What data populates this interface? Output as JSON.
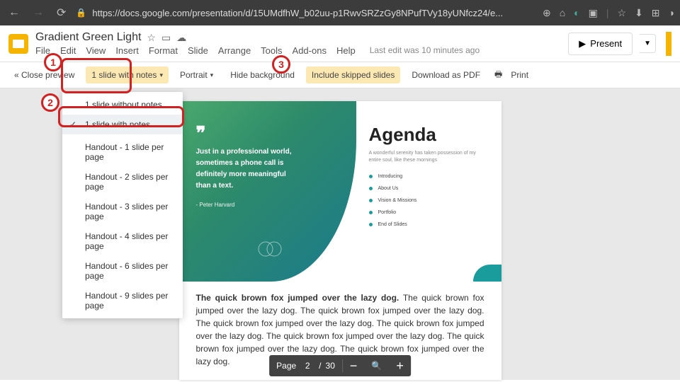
{
  "browser": {
    "url": "https://docs.google.com/presentation/d/15UMdfhW_b02uu-p1RwvSRZzGy8NPufTVy18yUNfcz24/e..."
  },
  "header": {
    "title": "Gradient Green Light",
    "menus": [
      "File",
      "Edit",
      "View",
      "Insert",
      "Format",
      "Slide",
      "Arrange",
      "Tools",
      "Add-ons",
      "Help"
    ],
    "last_edit": "Last edit was 10 minutes ago",
    "present": "Present"
  },
  "toolbar": {
    "close_preview": "« Close preview",
    "layout_dd": "1 slide with notes",
    "orientation": "Portrait",
    "hide_bg": "Hide background",
    "include_skipped": "Include skipped slides",
    "download_pdf": "Download as PDF",
    "print": "Print"
  },
  "dropdown": {
    "items": [
      "1 slide without notes",
      "1 slide with notes",
      "Handout - 1 slide per page",
      "Handout - 2 slides per page",
      "Handout - 3 slides per page",
      "Handout - 4 slides per page",
      "Handout - 6 slides per page",
      "Handout - 9 slides per page"
    ],
    "selected_index": 1
  },
  "slide": {
    "quote": {
      "text": "Just in a professional world, sometimes a phone call is definitely more meaningful than a text.",
      "author": "- Peter Harvard"
    },
    "agenda": {
      "title": "Agenda",
      "subtitle": "A wonderful serenity has taken possession of my entire soul, like these mornings",
      "items": [
        "Introducing",
        "About Us",
        "Vision & Missions",
        "Portfolio",
        "End of Slides"
      ]
    }
  },
  "notes": {
    "bold": "The quick brown fox jumped over the lazy dog.",
    "rest": " The quick brown fox jumped over the lazy dog. The quick brown fox jumped over the lazy dog. The quick brown fox jumped over the lazy dog. The quick brown fox jumped over the lazy dog. The quick brown fox jumped over the lazy dog. The quick brown fox jumped over the lazy dog. The quick brown fox jumped over the lazy dog."
  },
  "pagebar": {
    "label": "Page",
    "current": "2",
    "sep": "/",
    "total": "30"
  },
  "annotations": {
    "a1": "1",
    "a2": "2",
    "a3": "3"
  }
}
